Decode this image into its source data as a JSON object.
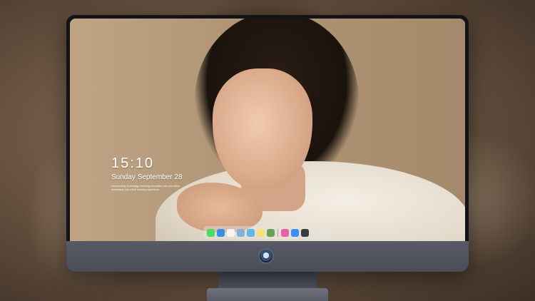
{
  "lock_screen": {
    "time": "15:10",
    "date": "Sunday September 28",
    "tagline": "Harmonizing technology, blending innovation with your ideas seamlessly into a fluid desktop experience"
  },
  "dock": {
    "apps": [
      {
        "name": "messages-icon",
        "color": "#4cd964"
      },
      {
        "name": "mail-icon",
        "color": "#3a8ee6"
      },
      {
        "name": "clock-icon",
        "color": "#f5f5f5"
      },
      {
        "name": "preview-icon",
        "color": "#7fb3d9"
      },
      {
        "name": "clapperboard-icon",
        "color": "#5fb6e8"
      },
      {
        "name": "notes-icon",
        "color": "#f7e27a"
      },
      {
        "name": "photos-icon",
        "color": "#6aa05a"
      },
      {
        "name": "music-icon",
        "color": "#e85fa6"
      },
      {
        "name": "app-store-icon",
        "color": "#3d8ef0"
      },
      {
        "name": "camera-icon",
        "color": "#3a3c44"
      }
    ]
  },
  "colors": {
    "bezel": "#131419",
    "chin": "#4f515d"
  }
}
